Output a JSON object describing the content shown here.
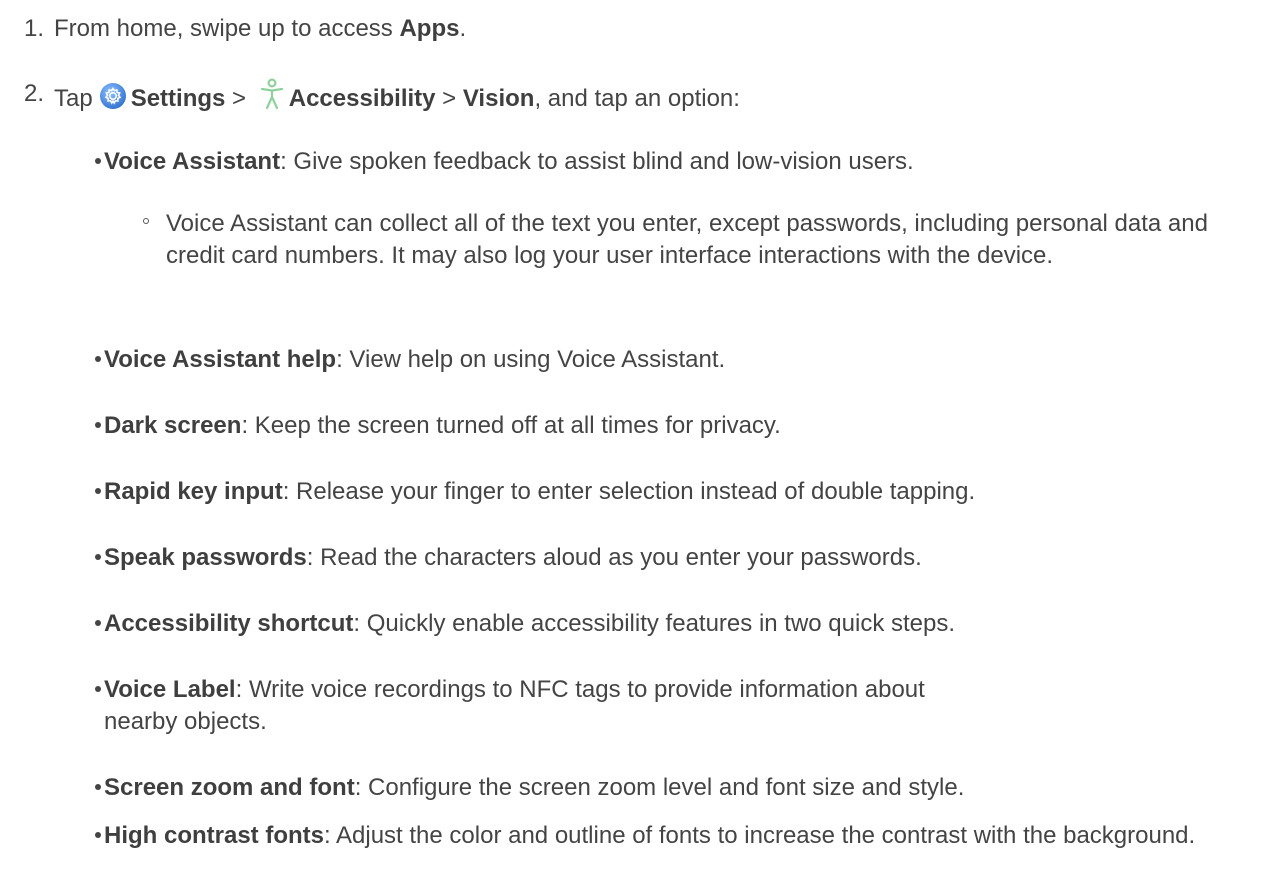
{
  "steps": [
    {
      "number": "1.",
      "pre": "From home, swipe up to access ",
      "bold": "Apps",
      "post": "."
    },
    {
      "number": "2.",
      "tap": "Tap",
      "settings": "Settings",
      "sep1": " > ",
      "accessibility": "Accessibility",
      "sep2": " > ",
      "vision": "Vision",
      "post": ", and tap an option:"
    }
  ],
  "options": [
    {
      "term": "Voice Assistant",
      "desc": ": Give spoken feedback to assist blind and low-vision users."
    },
    {
      "term": "Voice Assistant help",
      "desc": ": View help on using Voice Assistant."
    },
    {
      "term": "Dark screen",
      "desc": ": Keep the screen turned off at all times for privacy."
    },
    {
      "term": "Rapid key input",
      "desc": ": Release your finger to enter selection instead of double tapping."
    },
    {
      "term": "Speak passwords",
      "desc": ": Read the characters aloud as you enter your passwords."
    },
    {
      "term": "Accessibility shortcut",
      "desc": ": Quickly enable accessibility features in two quick steps."
    },
    {
      "term": "Voice Label",
      "desc": ": Write voice recordings to NFC tags to provide information about nearby objects."
    },
    {
      "term": "Screen zoom and font",
      "desc": ": Configure the screen zoom level and font size and style."
    },
    {
      "term": "High contrast fonts",
      "desc": ": Adjust the color and outline of fonts to increase the contrast with the background."
    }
  ],
  "sub_note": "Voice Assistant can collect all of the text you enter, except passwords, including personal data and credit card numbers. It may also log your user interface interactions with the device.",
  "icons": {
    "settings": "settings-gear-icon",
    "accessibility": "accessibility-person-icon"
  },
  "colors": {
    "text": "#444444",
    "settings_icon": "#3a7fd6",
    "accessibility_icon": "#8fd19e"
  }
}
